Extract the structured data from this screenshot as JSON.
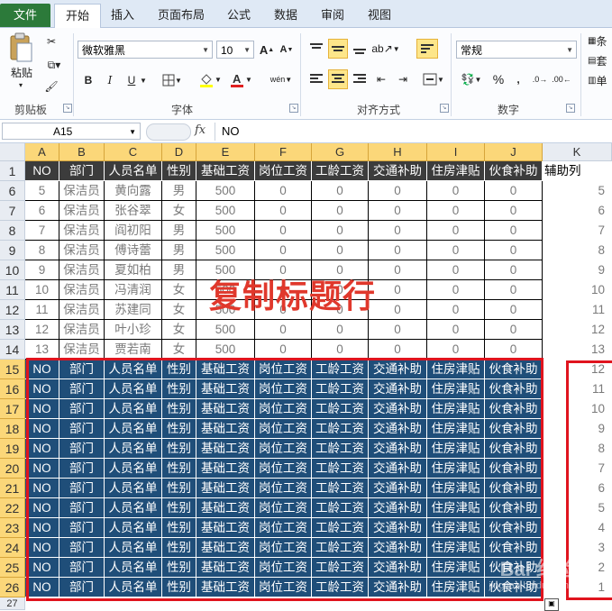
{
  "ribbon": {
    "tabs": [
      "文件",
      "开始",
      "插入",
      "页面布局",
      "公式",
      "数据",
      "审阅",
      "视图"
    ],
    "active_tab": "开始",
    "clipboard": {
      "paste_label": "粘贴",
      "group_label": "剪贴板"
    },
    "font": {
      "family": "微软雅黑",
      "size": "10",
      "group_label": "字体",
      "bold": "B",
      "italic": "I",
      "underline": "U"
    },
    "alignment": {
      "group_label": "对齐方式"
    },
    "number": {
      "format": "常规",
      "group_label": "数字",
      "percent": "%"
    },
    "styles": {
      "partial_labels": [
        "条",
        "套",
        "单"
      ]
    }
  },
  "formula_bar": {
    "name_box": "A15",
    "fx": "fx",
    "content": "NO"
  },
  "grid": {
    "column_letters": [
      "A",
      "B",
      "C",
      "D",
      "E",
      "F",
      "G",
      "H",
      "I",
      "J",
      "K"
    ],
    "header_row_number": "1",
    "headers": [
      "NO",
      "部门",
      "人员名单",
      "性别",
      "基础工资",
      "岗位工资",
      "工龄工资",
      "交通补助",
      "住房津贴",
      "伙食补助"
    ],
    "aux_header": "辅助列",
    "data_rows": [
      {
        "row": "6",
        "cells": [
          "5",
          "保洁员",
          "黄向露",
          "男",
          "500",
          "0",
          "0",
          "0",
          "0",
          "0"
        ],
        "aux": "5"
      },
      {
        "row": "7",
        "cells": [
          "6",
          "保洁员",
          "张谷翠",
          "女",
          "500",
          "0",
          "0",
          "0",
          "0",
          "0"
        ],
        "aux": "6"
      },
      {
        "row": "8",
        "cells": [
          "7",
          "保洁员",
          "阎初阳",
          "男",
          "500",
          "0",
          "0",
          "0",
          "0",
          "0"
        ],
        "aux": "7"
      },
      {
        "row": "9",
        "cells": [
          "8",
          "保洁员",
          "傅诗蕾",
          "男",
          "500",
          "0",
          "0",
          "0",
          "0",
          "0"
        ],
        "aux": "8"
      },
      {
        "row": "10",
        "cells": [
          "9",
          "保洁员",
          "夏如柏",
          "男",
          "500",
          "0",
          "0",
          "0",
          "0",
          "0"
        ],
        "aux": "9"
      },
      {
        "row": "11",
        "cells": [
          "10",
          "保洁员",
          "冯清润",
          "女",
          "500",
          "0",
          "0",
          "0",
          "0",
          "0"
        ],
        "aux": "10"
      },
      {
        "row": "12",
        "cells": [
          "11",
          "保洁员",
          "苏建同",
          "女",
          "500",
          "0",
          "0",
          "0",
          "0",
          "0"
        ],
        "aux": "11"
      },
      {
        "row": "13",
        "cells": [
          "12",
          "保洁员",
          "叶小珍",
          "女",
          "500",
          "0",
          "0",
          "0",
          "0",
          "0"
        ],
        "aux": "12"
      },
      {
        "row": "14",
        "cells": [
          "13",
          "保洁员",
          "贾若南",
          "女",
          "500",
          "0",
          "0",
          "0",
          "0",
          "0"
        ],
        "aux": "13"
      }
    ],
    "copied_rows": [
      {
        "row": "15",
        "aux": "12"
      },
      {
        "row": "16",
        "aux": "11"
      },
      {
        "row": "17",
        "aux": "10"
      },
      {
        "row": "18",
        "aux": "9"
      },
      {
        "row": "19",
        "aux": "8"
      },
      {
        "row": "20",
        "aux": "7"
      },
      {
        "row": "21",
        "aux": "6"
      },
      {
        "row": "22",
        "aux": "5"
      },
      {
        "row": "23",
        "aux": "4"
      },
      {
        "row": "24",
        "aux": "3"
      },
      {
        "row": "25",
        "aux": "2"
      },
      {
        "row": "26",
        "aux": "1"
      }
    ],
    "partial_row": "27"
  },
  "annotation": "复制标题行",
  "watermark": {
    "text": "Bai 经验",
    "url": "jingyan.baidu.com"
  },
  "colors": {
    "header_bg": "#3c3c3c",
    "copied_bg": "#1f4e79",
    "selection_header": "#fbd779",
    "annotation": "#e0382c"
  }
}
